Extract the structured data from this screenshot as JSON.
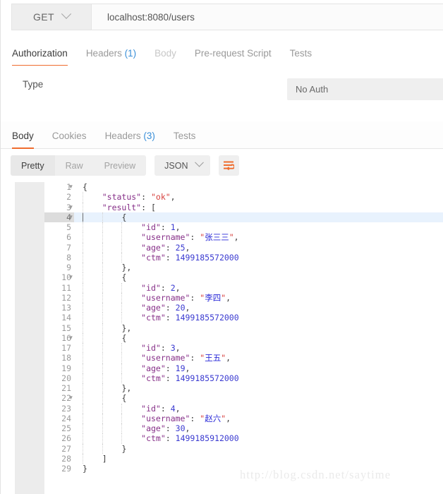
{
  "request": {
    "method": "GET",
    "url": "localhost:8080/users",
    "method_caret_icon": "chevron-down-icon",
    "tabs": [
      {
        "label": "Authorization",
        "state": "active",
        "count": ""
      },
      {
        "label": "Headers",
        "state": "normal",
        "count": "(1)"
      },
      {
        "label": "Body",
        "state": "dim",
        "count": ""
      },
      {
        "label": "Pre-request Script",
        "state": "normal",
        "count": ""
      },
      {
        "label": "Tests",
        "state": "normal",
        "count": ""
      }
    ],
    "auth": {
      "type_label": "Type",
      "selected_type": "No Auth"
    }
  },
  "response": {
    "tabs": [
      {
        "label": "Body",
        "state": "active",
        "count": ""
      },
      {
        "label": "Cookies",
        "state": "normal",
        "count": ""
      },
      {
        "label": "Headers",
        "state": "normal",
        "count": "(3)"
      },
      {
        "label": "Tests",
        "state": "normal",
        "count": ""
      }
    ],
    "toolbar": {
      "view_modes": [
        "Pretty",
        "Raw",
        "Preview"
      ],
      "active_view_mode": "Pretty",
      "format": "JSON",
      "format_caret_icon": "chevron-down-icon",
      "wrap_button_icon": "wrap-lines-icon",
      "wrap_icon_color": "#ef6c2e"
    },
    "editor": {
      "active_line": 4,
      "total_lines": 29,
      "lines": [
        {
          "n": 1,
          "fold": true,
          "indent": 0,
          "tokens": [
            {
              "t": "p",
              "v": "{"
            }
          ]
        },
        {
          "n": 2,
          "fold": false,
          "indent": 1,
          "tokens": [
            {
              "t": "k",
              "v": "\"status\""
            },
            {
              "t": "p",
              "v": ": "
            },
            {
              "t": "s",
              "v": "\"ok\""
            },
            {
              "t": "p",
              "v": ","
            }
          ]
        },
        {
          "n": 3,
          "fold": true,
          "indent": 1,
          "tokens": [
            {
              "t": "k",
              "v": "\"result\""
            },
            {
              "t": "p",
              "v": ": ["
            }
          ]
        },
        {
          "n": 4,
          "fold": true,
          "indent": 2,
          "tokens": [
            {
              "t": "p",
              "v": "{"
            }
          ]
        },
        {
          "n": 5,
          "fold": false,
          "indent": 3,
          "tokens": [
            {
              "t": "k",
              "v": "\"id\""
            },
            {
              "t": "p",
              "v": ": "
            },
            {
              "t": "n",
              "v": "1"
            },
            {
              "t": "p",
              "v": ","
            }
          ]
        },
        {
          "n": 6,
          "fold": false,
          "indent": 3,
          "tokens": [
            {
              "t": "k",
              "v": "\"username\""
            },
            {
              "t": "p",
              "v": ": "
            },
            {
              "t": "s",
              "v": "\""
            },
            {
              "t": "cjk",
              "v": "张三三"
            },
            {
              "t": "s",
              "v": "\""
            },
            {
              "t": "p",
              "v": ","
            }
          ]
        },
        {
          "n": 7,
          "fold": false,
          "indent": 3,
          "tokens": [
            {
              "t": "k",
              "v": "\"age\""
            },
            {
              "t": "p",
              "v": ": "
            },
            {
              "t": "n",
              "v": "25"
            },
            {
              "t": "p",
              "v": ","
            }
          ]
        },
        {
          "n": 8,
          "fold": false,
          "indent": 3,
          "tokens": [
            {
              "t": "k",
              "v": "\"ctm\""
            },
            {
              "t": "p",
              "v": ": "
            },
            {
              "t": "n",
              "v": "1499185572000"
            }
          ]
        },
        {
          "n": 9,
          "fold": false,
          "indent": 2,
          "tokens": [
            {
              "t": "p",
              "v": "},"
            }
          ]
        },
        {
          "n": 10,
          "fold": true,
          "indent": 2,
          "tokens": [
            {
              "t": "p",
              "v": "{"
            }
          ]
        },
        {
          "n": 11,
          "fold": false,
          "indent": 3,
          "tokens": [
            {
              "t": "k",
              "v": "\"id\""
            },
            {
              "t": "p",
              "v": ": "
            },
            {
              "t": "n",
              "v": "2"
            },
            {
              "t": "p",
              "v": ","
            }
          ]
        },
        {
          "n": 12,
          "fold": false,
          "indent": 3,
          "tokens": [
            {
              "t": "k",
              "v": "\"username\""
            },
            {
              "t": "p",
              "v": ": "
            },
            {
              "t": "s",
              "v": "\""
            },
            {
              "t": "cjk",
              "v": "李四"
            },
            {
              "t": "s",
              "v": "\""
            },
            {
              "t": "p",
              "v": ","
            }
          ]
        },
        {
          "n": 13,
          "fold": false,
          "indent": 3,
          "tokens": [
            {
              "t": "k",
              "v": "\"age\""
            },
            {
              "t": "p",
              "v": ": "
            },
            {
              "t": "n",
              "v": "20"
            },
            {
              "t": "p",
              "v": ","
            }
          ]
        },
        {
          "n": 14,
          "fold": false,
          "indent": 3,
          "tokens": [
            {
              "t": "k",
              "v": "\"ctm\""
            },
            {
              "t": "p",
              "v": ": "
            },
            {
              "t": "n",
              "v": "1499185572000"
            }
          ]
        },
        {
          "n": 15,
          "fold": false,
          "indent": 2,
          "tokens": [
            {
              "t": "p",
              "v": "},"
            }
          ]
        },
        {
          "n": 16,
          "fold": true,
          "indent": 2,
          "tokens": [
            {
              "t": "p",
              "v": "{"
            }
          ]
        },
        {
          "n": 17,
          "fold": false,
          "indent": 3,
          "tokens": [
            {
              "t": "k",
              "v": "\"id\""
            },
            {
              "t": "p",
              "v": ": "
            },
            {
              "t": "n",
              "v": "3"
            },
            {
              "t": "p",
              "v": ","
            }
          ]
        },
        {
          "n": 18,
          "fold": false,
          "indent": 3,
          "tokens": [
            {
              "t": "k",
              "v": "\"username\""
            },
            {
              "t": "p",
              "v": ": "
            },
            {
              "t": "s",
              "v": "\""
            },
            {
              "t": "cjk",
              "v": "王五"
            },
            {
              "t": "s",
              "v": "\""
            },
            {
              "t": "p",
              "v": ","
            }
          ]
        },
        {
          "n": 19,
          "fold": false,
          "indent": 3,
          "tokens": [
            {
              "t": "k",
              "v": "\"age\""
            },
            {
              "t": "p",
              "v": ": "
            },
            {
              "t": "n",
              "v": "19"
            },
            {
              "t": "p",
              "v": ","
            }
          ]
        },
        {
          "n": 20,
          "fold": false,
          "indent": 3,
          "tokens": [
            {
              "t": "k",
              "v": "\"ctm\""
            },
            {
              "t": "p",
              "v": ": "
            },
            {
              "t": "n",
              "v": "1499185572000"
            }
          ]
        },
        {
          "n": 21,
          "fold": false,
          "indent": 2,
          "tokens": [
            {
              "t": "p",
              "v": "},"
            }
          ]
        },
        {
          "n": 22,
          "fold": true,
          "indent": 2,
          "tokens": [
            {
              "t": "p",
              "v": "{"
            }
          ]
        },
        {
          "n": 23,
          "fold": false,
          "indent": 3,
          "tokens": [
            {
              "t": "k",
              "v": "\"id\""
            },
            {
              "t": "p",
              "v": ": "
            },
            {
              "t": "n",
              "v": "4"
            },
            {
              "t": "p",
              "v": ","
            }
          ]
        },
        {
          "n": 24,
          "fold": false,
          "indent": 3,
          "tokens": [
            {
              "t": "k",
              "v": "\"username\""
            },
            {
              "t": "p",
              "v": ": "
            },
            {
              "t": "s",
              "v": "\""
            },
            {
              "t": "cjk",
              "v": "赵六"
            },
            {
              "t": "s",
              "v": "\""
            },
            {
              "t": "p",
              "v": ","
            }
          ]
        },
        {
          "n": 25,
          "fold": false,
          "indent": 3,
          "tokens": [
            {
              "t": "k",
              "v": "\"age\""
            },
            {
              "t": "p",
              "v": ": "
            },
            {
              "t": "n",
              "v": "30"
            },
            {
              "t": "p",
              "v": ","
            }
          ]
        },
        {
          "n": 26,
          "fold": false,
          "indent": 3,
          "tokens": [
            {
              "t": "k",
              "v": "\"ctm\""
            },
            {
              "t": "p",
              "v": ": "
            },
            {
              "t": "n",
              "v": "1499185912000"
            }
          ]
        },
        {
          "n": 27,
          "fold": false,
          "indent": 2,
          "tokens": [
            {
              "t": "p",
              "v": "}"
            }
          ]
        },
        {
          "n": 28,
          "fold": false,
          "indent": 1,
          "tokens": [
            {
              "t": "p",
              "v": "]"
            }
          ]
        },
        {
          "n": 29,
          "fold": false,
          "indent": 0,
          "tokens": [
            {
              "t": "p",
              "v": "}"
            }
          ]
        }
      ]
    }
  },
  "watermark": {
    "text": "http://blog.csdn.net/saytime"
  },
  "colors": {
    "accent": "#ef6c2e",
    "link": "#3a8fd8",
    "json_key": "#862f88",
    "json_string": "#d6403d",
    "json_number": "#3a3ad0",
    "active_line": "#e8f2fd"
  }
}
